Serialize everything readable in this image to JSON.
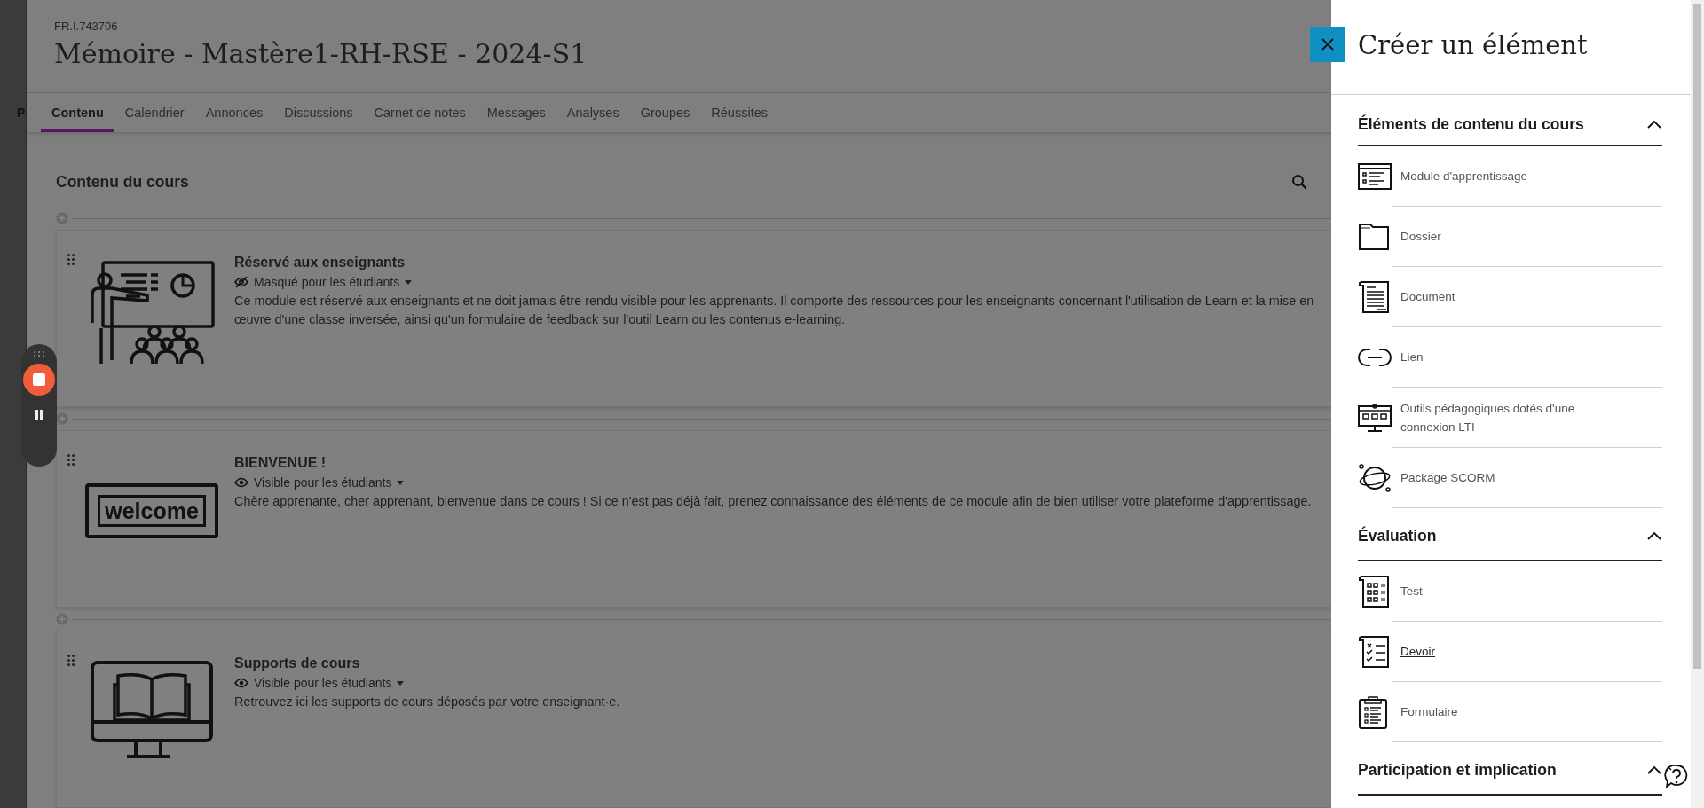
{
  "left_strip": {
    "text": "P"
  },
  "course": {
    "code": "FR.I.743706",
    "title": "Mémoire - Mastère1-RH-RSE - 2024-S1"
  },
  "tabs": [
    {
      "label": "Contenu",
      "selected": true
    },
    {
      "label": "Calendrier",
      "selected": false
    },
    {
      "label": "Annonces",
      "selected": false
    },
    {
      "label": "Discussions",
      "selected": false
    },
    {
      "label": "Carnet de notes",
      "selected": false
    },
    {
      "label": "Messages",
      "selected": false
    },
    {
      "label": "Analyses",
      "selected": false
    },
    {
      "label": "Groupes",
      "selected": false
    },
    {
      "label": "Réussites",
      "selected": false
    }
  ],
  "content": {
    "heading": "Contenu du cours",
    "items": [
      {
        "title": "Réservé aux enseignants",
        "visible": false,
        "visibility_label": "Masqué pour les étudiants",
        "description": "Ce module est réservé aux enseignants et ne doit jamais être rendu visible pour les apprenants. Il comporte des ressources pour les enseignants concernant l'utilisation de Learn et la mise en œuvre d'une classe inversée, ainsi qu'un formulaire de feedback sur l'outil Learn ou les contenus e-learning."
      },
      {
        "title": "BIENVENUE !",
        "visible": true,
        "visibility_label": "Visible pour les étudiants",
        "description": "Chère apprenante, cher apprenant, bienvenue dans ce cours ! Si ce n'est pas déjà fait, prenez connaissance des éléments de ce module afin de bien utiliser votre plateforme d'apprentissage.",
        "sign_text": "welcome"
      },
      {
        "title": "Supports de cours",
        "visible": true,
        "visibility_label": "Visible pour les étudiants",
        "description": "Retrouvez ici les supports de cours déposés par votre enseignant·e."
      }
    ]
  },
  "panel": {
    "title": "Créer un élément",
    "sections": [
      {
        "title": "Éléments de contenu du cours",
        "expanded": true,
        "items": [
          {
            "label": "Module d'apprentissage",
            "hovered": false
          },
          {
            "label": "Dossier",
            "hovered": false
          },
          {
            "label": "Document",
            "hovered": false
          },
          {
            "label": "Lien",
            "hovered": false
          },
          {
            "label": "Outils pédagogiques dotés d'une connexion LTI",
            "hovered": false
          },
          {
            "label": "Package SCORM",
            "hovered": false
          }
        ]
      },
      {
        "title": "Évaluation",
        "expanded": true,
        "items": [
          {
            "label": "Test",
            "hovered": false
          },
          {
            "label": "Devoir",
            "hovered": true
          },
          {
            "label": "Formulaire",
            "hovered": false
          }
        ]
      },
      {
        "title": "Participation et implication",
        "expanded": true
      }
    ]
  }
}
